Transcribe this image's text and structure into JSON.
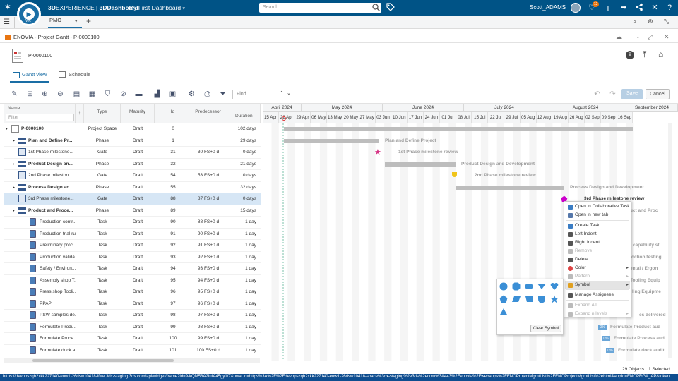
{
  "app": {
    "brand_3d": "3D",
    "brand_experience": "EXPERIENCE",
    "brand_sep": " | ",
    "brand_dash": "3DDashboard",
    "dashboard_name": "My First Dashboard",
    "compass_label": "V,R",
    "search_placeholder": "Search",
    "user_name": "Scott_ADAMS",
    "notification_count": "12",
    "tab_label": "PMO"
  },
  "widget": {
    "title": "ENOVIA - Project Gantt - P-0000100",
    "object_name": "P-0000100",
    "tabs": [
      {
        "label": "Gantt view",
        "active": true
      },
      {
        "label": "Schedule",
        "active": false
      }
    ],
    "find_placeholder": "Find",
    "save_label": "Save",
    "cancel_label": "Cancel"
  },
  "grid": {
    "headers": {
      "name": "Name",
      "filter_placeholder": "Filter",
      "type": "Type",
      "maturity": "Maturity",
      "id": "Id",
      "predecessor": "Predecessor",
      "duration": "Duration"
    },
    "rows": [
      {
        "name": "P-0000100",
        "type": "Project Space",
        "maturity": "Draft",
        "id": "0",
        "pred": "",
        "dur": "102 days",
        "bold": true,
        "level": 0,
        "expander": "▾",
        "kind": "project"
      },
      {
        "name": "Plan and Define Pr...",
        "type": "Phase",
        "maturity": "Draft",
        "id": "1",
        "pred": "",
        "dur": "29 days",
        "bold": true,
        "level": 1,
        "expander": "▸",
        "kind": "phase"
      },
      {
        "name": "1st Phase milestone...",
        "type": "Gate",
        "maturity": "Draft",
        "id": "31",
        "pred": "30 FS+0 d",
        "dur": "0 days",
        "bold": false,
        "level": 1,
        "expander": "",
        "kind": "gate"
      },
      {
        "name": "Product Design an...",
        "type": "Phase",
        "maturity": "Draft",
        "id": "32",
        "pred": "",
        "dur": "21 days",
        "bold": true,
        "level": 1,
        "expander": "▸",
        "kind": "phase"
      },
      {
        "name": "2nd Phase mileston...",
        "type": "Gate",
        "maturity": "Draft",
        "id": "54",
        "pred": "53 FS+0 d",
        "dur": "0 days",
        "bold": false,
        "level": 1,
        "expander": "",
        "kind": "gate"
      },
      {
        "name": "Process Design an...",
        "type": "Phase",
        "maturity": "Draft",
        "id": "55",
        "pred": "",
        "dur": "32 days",
        "bold": true,
        "level": 1,
        "expander": "▸",
        "kind": "phase"
      },
      {
        "name": "3rd Phase milestone...",
        "type": "Gate",
        "maturity": "Draft",
        "id": "88",
        "pred": "87 FS+0 d",
        "dur": "0 days",
        "bold": false,
        "level": 1,
        "expander": "",
        "kind": "gate",
        "selected": true
      },
      {
        "name": "Product and Proce...",
        "type": "Phase",
        "maturity": "Draft",
        "id": "89",
        "pred": "",
        "dur": "15 days",
        "bold": true,
        "level": 1,
        "expander": "▾",
        "kind": "phase"
      },
      {
        "name": "Production contr...",
        "type": "Task",
        "maturity": "Draft",
        "id": "90",
        "pred": "88 FS+0 d",
        "dur": "1 day",
        "bold": false,
        "level": 2,
        "expander": "",
        "kind": "task"
      },
      {
        "name": "Production trial run",
        "type": "Task",
        "maturity": "Draft",
        "id": "91",
        "pred": "90 FS+0 d",
        "dur": "1 day",
        "bold": false,
        "level": 2,
        "expander": "",
        "kind": "task"
      },
      {
        "name": "Preliminary proc...",
        "type": "Task",
        "maturity": "Draft",
        "id": "92",
        "pred": "91 FS+0 d",
        "dur": "1 day",
        "bold": false,
        "level": 2,
        "expander": "",
        "kind": "task"
      },
      {
        "name": "Production valida...",
        "type": "Task",
        "maturity": "Draft",
        "id": "93",
        "pred": "92 FS+0 d",
        "dur": "1 day",
        "bold": false,
        "level": 2,
        "expander": "",
        "kind": "task"
      },
      {
        "name": "Safety / Environ...",
        "type": "Task",
        "maturity": "Draft",
        "id": "94",
        "pred": "93 FS+0 d",
        "dur": "1 day",
        "bold": false,
        "level": 2,
        "expander": "",
        "kind": "task"
      },
      {
        "name": "Assembly shop T...",
        "type": "Task",
        "maturity": "Draft",
        "id": "95",
        "pred": "94 FS+0 d",
        "dur": "1 day",
        "bold": false,
        "level": 2,
        "expander": "",
        "kind": "task"
      },
      {
        "name": "Press shop Tooli...",
        "type": "Task",
        "maturity": "Draft",
        "id": "96",
        "pred": "95 FS+0 d",
        "dur": "1 day",
        "bold": false,
        "level": 2,
        "expander": "",
        "kind": "task"
      },
      {
        "name": "PPAP",
        "type": "Task",
        "maturity": "Draft",
        "id": "97",
        "pred": "96 FS+0 d",
        "dur": "1 day",
        "bold": false,
        "level": 2,
        "expander": "",
        "kind": "task"
      },
      {
        "name": "PSW samples de...",
        "type": "Task",
        "maturity": "Draft",
        "id": "98",
        "pred": "97 FS+0 d",
        "dur": "1 day",
        "bold": false,
        "level": 2,
        "expander": "",
        "kind": "task"
      },
      {
        "name": "Formulate Produ...",
        "type": "Task",
        "maturity": "Draft",
        "id": "99",
        "pred": "98 FS+0 d",
        "dur": "1 day",
        "bold": false,
        "level": 2,
        "expander": "",
        "kind": "task"
      },
      {
        "name": "Formulate Proce...",
        "type": "Task",
        "maturity": "Draft",
        "id": "100",
        "pred": "99 FS+0 d",
        "dur": "1 day",
        "bold": false,
        "level": 2,
        "expander": "",
        "kind": "task"
      },
      {
        "name": "Formulate dock a...",
        "type": "Task",
        "maturity": "Draft",
        "id": "101",
        "pred": "100 FS+0 d",
        "dur": "1 day",
        "bold": false,
        "level": 2,
        "expander": "",
        "kind": "task"
      }
    ]
  },
  "timeline": {
    "months": [
      "April 2024",
      "May 2024",
      "June 2024",
      "July 2024",
      "August 2024",
      "September 2024"
    ],
    "days": [
      "15 Apr",
      "22 Apr",
      "29 Apr",
      "06 May",
      "13 May",
      "20 May",
      "27 May",
      "03 Jun",
      "10 Jun",
      "17 Jun",
      "24 Jun",
      "01 Jul",
      "08 Jul",
      "15 Jul",
      "22 Jul",
      "29 Jul",
      "05 Aug",
      "12 Aug",
      "19 Aug",
      "26 Aug",
      "02 Sep",
      "09 Sep",
      "16 Sep"
    ],
    "labels": {
      "plan": "Plan and Define Project",
      "m1": "1st Phase milestone review",
      "pdd": "Product Design and Development",
      "m2": "2nd Phase milestone review",
      "prd": "Process Design and Development",
      "m3": "3rd Phase milestone review",
      "ppv": "oduct and Proc",
      "cap": "capability st",
      "prodtest": "oction testing",
      "env": "ental / Ergon",
      "tool1": "Tooling Equip",
      "tool2": "ling Equipme",
      "deliv": "es delivered",
      "fpa": "Formulate Product aud",
      "fpra": "Formulate Process aud",
      "fda": "Formulate dock audit",
      "pct": "0%"
    }
  },
  "context_menu": {
    "items": [
      {
        "label": "Open in Collaborative Task",
        "disabled": false
      },
      {
        "label": "Open in new tab",
        "disabled": false
      },
      {
        "label": "Create Task",
        "disabled": false
      },
      {
        "label": "Left Indent",
        "disabled": false
      },
      {
        "label": "Right Indent",
        "disabled": false
      },
      {
        "label": "Remove",
        "disabled": true
      },
      {
        "label": "Delete",
        "disabled": false
      },
      {
        "label": "Color",
        "disabled": false
      },
      {
        "label": "Pattern",
        "disabled": true
      },
      {
        "label": "Symbol",
        "disabled": false
      },
      {
        "label": "Manage Assignees",
        "disabled": false
      },
      {
        "label": "Expand All",
        "disabled": true
      },
      {
        "label": "Expand n levels",
        "disabled": true
      }
    ],
    "clear_symbol": "Clear Symbol"
  },
  "status": {
    "objects": "29 Objects",
    "selected": "1 Selected",
    "url": "https://devopszqh2xkk227140-euw1-26dsw10418-ifwe.3dx-staging.3ds.com/api/widget/frame?id=9-kQM58A2IuIA45gy1/7&uwaUrl=https%3A%2F%2Fdevopszqh2xkk227140-euw1-26dsw10418-space%3dx-staging%2e3ds%2ecom%3A443%2Fenovia%2Fwebapps%2FENOProjectMgmtList%2FENOProjectMgmtList%2ehtml&appId=ENOPRGA_AP&token..."
  },
  "colors": {
    "topbar": "#005386",
    "accent": "#1a6ea5",
    "bar_gray": "#bdbdbd",
    "milestone_pink": "#d63384",
    "milestone_yellow": "#f0c419",
    "milestone_magenta": "#cc00cc",
    "symbol_blue": "#3b8fd6",
    "selected_row": "#d6e6f5"
  }
}
